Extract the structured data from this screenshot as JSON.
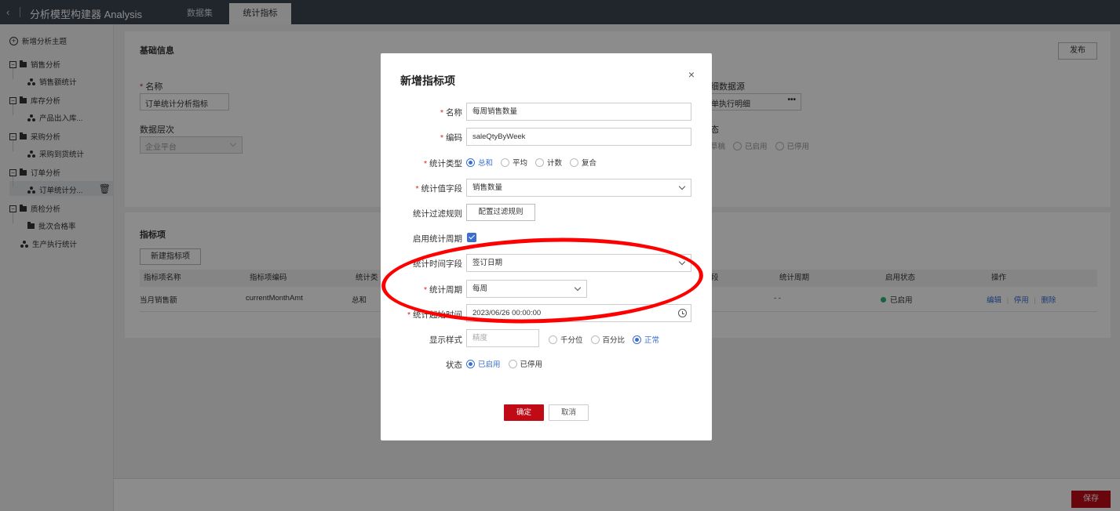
{
  "app": {
    "title": "分析模型构建器 Analysis",
    "back_glyph": "‹",
    "tabs": [
      {
        "label": "数据集"
      },
      {
        "label": "统计指标"
      }
    ]
  },
  "sidebar": {
    "add_label": "新增分析主题",
    "groups": [
      {
        "label": "销售分析",
        "child": "销售额统计"
      },
      {
        "label": "库存分析",
        "child": "产品出入库..."
      },
      {
        "label": "采购分析",
        "child": "采购到货统计"
      },
      {
        "label": "订单分析",
        "child": "订单统计分..."
      },
      {
        "label": "质检分析",
        "child": "批次合格率"
      }
    ],
    "standalone": "生产执行统计"
  },
  "basic": {
    "section_title": "基础信息",
    "publish_label": "发布",
    "name_label": "名称",
    "name_value": "订单统计分析指标",
    "level_label": "数据层次",
    "level_value": "企业平台",
    "detail_source_label": "细数据源",
    "detail_source_value": "单执行明细",
    "status_tail_label": "态",
    "status_options": [
      "草稿",
      "已启用",
      "已停用"
    ]
  },
  "metrics": {
    "section_title": "指标项",
    "new_button": "新建指标项",
    "columns": [
      "指标项名称",
      "指标项编码",
      "统计类",
      "段",
      "统计周期",
      "启用状态",
      "操作"
    ],
    "row": {
      "name": "当月销售额",
      "code": "currentMonthAmt",
      "type": "总和",
      "period": "- -",
      "status": "已启用",
      "actions": [
        "编辑",
        "停用",
        "删除"
      ],
      "action_sep": "|"
    }
  },
  "footer": {
    "save_label": "保存"
  },
  "modal": {
    "title": "新增指标项",
    "close_glyph": "×",
    "name_label": "名称",
    "name_value": "每周销售数量",
    "code_label": "编码",
    "code_value": "saleQtyByWeek",
    "stat_type_label": "统计类型",
    "stat_type_options": [
      "总和",
      "平均",
      "计数",
      "复合"
    ],
    "stat_type_selected": "总和",
    "value_field_label": "统计值字段",
    "value_field_value": "销售数量",
    "filter_label": "统计过滤规则",
    "filter_button": "配置过滤规则",
    "enable_period_label": "启用统计周期",
    "enable_period_checked": true,
    "time_field_label": "统计时间字段",
    "time_field_value": "签订日期",
    "period_label": "统计周期",
    "period_value": "每周",
    "start_time_label": "统计起始时间",
    "start_time_value": "2023/06/26 00:00:00",
    "display_label": "显示样式",
    "precision_placeholder": "精度",
    "display_options": [
      "千分位",
      "百分比",
      "正常"
    ],
    "display_selected": "正常",
    "status_label": "状态",
    "status_options": [
      "已启用",
      "已停用"
    ],
    "status_selected": "已启用",
    "confirm_label": "确定",
    "cancel_label": "取消"
  },
  "colors": {
    "topbar": "#3d4450",
    "primary_red": "#c00a16",
    "link_blue": "#3a6fd0",
    "annotation_red": "#ff0000"
  }
}
